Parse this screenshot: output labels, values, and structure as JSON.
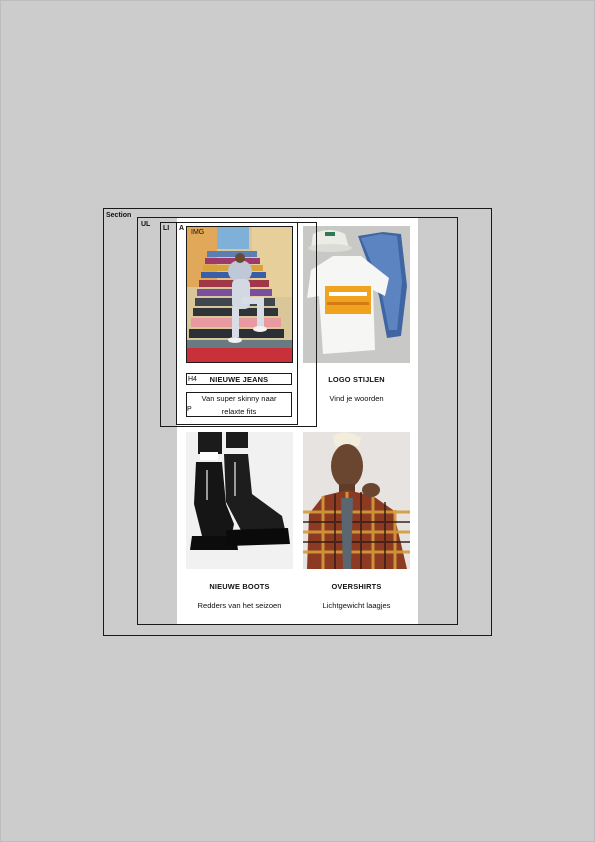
{
  "outline_labels": {
    "section": "Section",
    "ul": "UL",
    "li": "LI",
    "a": "A",
    "img": "IMG",
    "h4": "H4",
    "p": "P"
  },
  "cards": [
    {
      "title": "NIEUWE JEANS",
      "subtitle_line1": "Van super skinny naar",
      "subtitle_line2": "relaxte fits",
      "image": "man-on-colored-stairs"
    },
    {
      "title": "LOGO STIJLEN",
      "subtitle": "Vind je woorden",
      "image": "logo-tshirt-jeans-cap"
    },
    {
      "title": "NIEUWE BOOTS",
      "subtitle": "Redders van het seizoen",
      "image": "black-chunky-boots"
    },
    {
      "title": "OVERSHIRTS",
      "subtitle": "Lichtgewicht laagjes",
      "image": "man-in-plaid-overshirt"
    }
  ],
  "colors": {
    "background": "#cccccc",
    "panel": "#ffffff",
    "outline": "#1a1a1a",
    "text": "#111111"
  }
}
